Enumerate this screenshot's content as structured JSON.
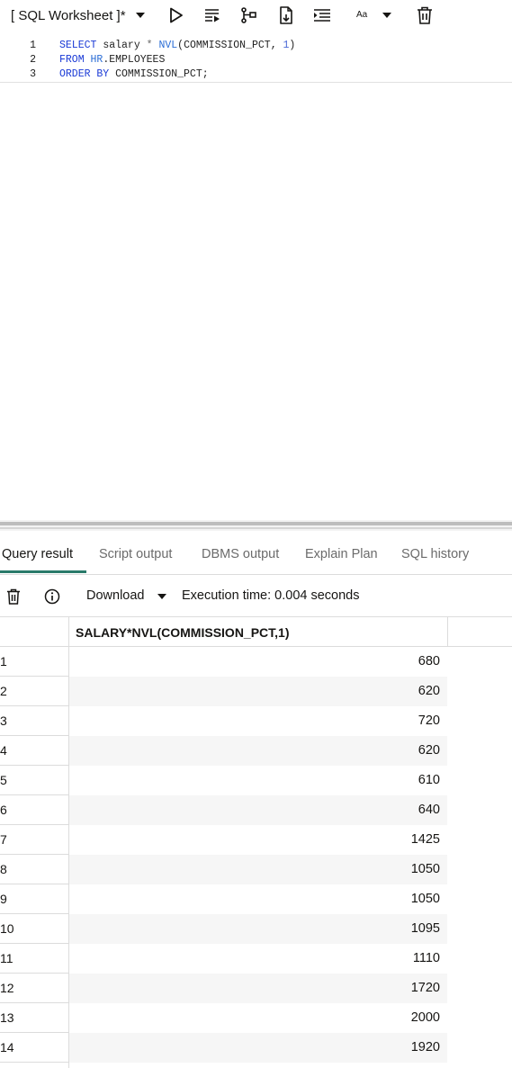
{
  "toolbar": {
    "title": "[ SQL Worksheet ]*",
    "font_label": "Aa",
    "icons": [
      "chevron-down-icon",
      "run-icon",
      "run-script-icon",
      "explain-plan-icon",
      "download-file-icon",
      "format-icon",
      "font-size-icon",
      "trash-icon"
    ]
  },
  "editor": {
    "lines": [
      {
        "num": "1",
        "parts": [
          {
            "t": "SELECT",
            "c": "kw"
          },
          {
            "t": " salary ",
            "c": ""
          },
          {
            "t": "*",
            "c": "op"
          },
          {
            "t": " ",
            "c": ""
          },
          {
            "t": "NVL",
            "c": "fn"
          },
          {
            "t": "(COMMISSION_PCT, ",
            "c": ""
          },
          {
            "t": "1",
            "c": "num"
          },
          {
            "t": ")",
            "c": ""
          }
        ]
      },
      {
        "num": "2",
        "parts": [
          {
            "t": "FROM",
            "c": "kw"
          },
          {
            "t": " ",
            "c": ""
          },
          {
            "t": "HR",
            "c": "fn"
          },
          {
            "t": ".EMPLOYEES",
            "c": ""
          }
        ]
      },
      {
        "num": "3",
        "parts": [
          {
            "t": "ORDER BY",
            "c": "kw"
          },
          {
            "t": " COMMISSION_PCT;",
            "c": ""
          }
        ]
      }
    ]
  },
  "tabs": [
    {
      "label": "Query result",
      "active": true
    },
    {
      "label": "Script output",
      "active": false
    },
    {
      "label": "DBMS output",
      "active": false
    },
    {
      "label": "Explain Plan",
      "active": false
    },
    {
      "label": "SQL history",
      "active": false
    }
  ],
  "result_bar": {
    "download_label": "Download",
    "execution_time": "Execution time: 0.004 seconds"
  },
  "grid": {
    "column_header": "SALARY*NVL(COMMISSION_PCT,1)",
    "rows": [
      {
        "n": "1",
        "v": "680"
      },
      {
        "n": "2",
        "v": "620"
      },
      {
        "n": "3",
        "v": "720"
      },
      {
        "n": "4",
        "v": "620"
      },
      {
        "n": "5",
        "v": "610"
      },
      {
        "n": "6",
        "v": "640"
      },
      {
        "n": "7",
        "v": "1425"
      },
      {
        "n": "8",
        "v": "1050"
      },
      {
        "n": "9",
        "v": "1050"
      },
      {
        "n": "10",
        "v": "1095"
      },
      {
        "n": "11",
        "v": "1110"
      },
      {
        "n": "12",
        "v": "1720"
      },
      {
        "n": "13",
        "v": "2000"
      },
      {
        "n": "14",
        "v": "1920"
      }
    ]
  }
}
